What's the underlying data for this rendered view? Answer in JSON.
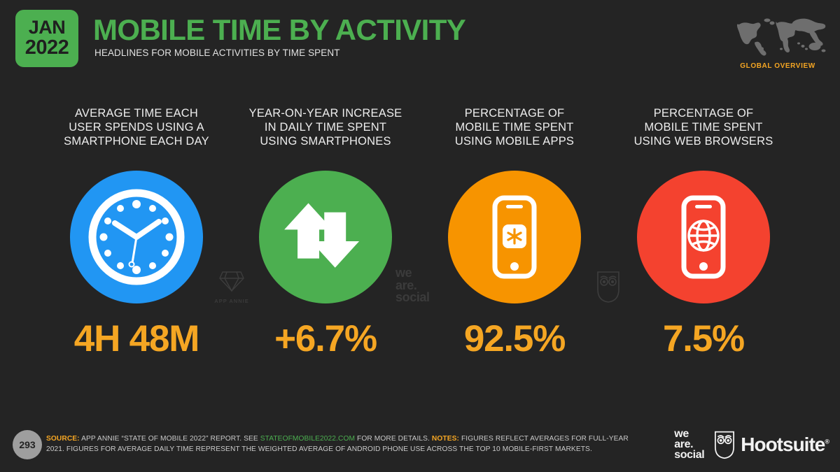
{
  "header": {
    "date_month": "JAN",
    "date_year": "2022",
    "title": "MOBILE TIME BY ACTIVITY",
    "subtitle": "HEADLINES FOR MOBILE ACTIVITIES BY TIME SPENT",
    "global_overview_label": "GLOBAL OVERVIEW"
  },
  "colors": {
    "background": "#242424",
    "brand_green": "#4caf50",
    "accent_orange": "#f5a623",
    "circle_blue": "#2196f3",
    "circle_green": "#4caf50",
    "circle_orange": "#f79400",
    "circle_red": "#f4422f"
  },
  "columns": [
    {
      "heading": "AVERAGE TIME EACH\nUSER SPENDS USING A\nSMARTPHONE EACH DAY",
      "icon": "clock-icon",
      "circle_color": "#2196f3",
      "value": "4H 48M"
    },
    {
      "heading": "YEAR-ON-YEAR INCREASE\nIN DAILY TIME SPENT\nUSING SMARTPHONES",
      "icon": "up-down-arrows-icon",
      "circle_color": "#4caf50",
      "value": "+6.7%"
    },
    {
      "heading": "PERCENTAGE OF\nMOBILE TIME SPENT\nUSING MOBILE APPS",
      "icon": "smartphone-app-icon",
      "circle_color": "#f79400",
      "value": "92.5%"
    },
    {
      "heading": "PERCENTAGE OF\nMOBILE TIME SPENT\nUSING WEB BROWSERS",
      "icon": "smartphone-browser-icon",
      "circle_color": "#f4422f",
      "value": "7.5%"
    }
  ],
  "watermarks": {
    "app_annie": "APP ANNIE",
    "we_are_social_l1": "we",
    "we_are_social_l2": "are.",
    "we_are_social_l3": "social",
    "hootsuite_owl": "hootsuite-owl-icon"
  },
  "footer": {
    "page_number": "293",
    "source_label": "SOURCE:",
    "source_text_1": "APP ANNIE “STATE OF MOBILE 2022” REPORT. SEE",
    "source_link": "STATEOFMOBILE2022.COM",
    "source_text_2": "FOR MORE DETAILS.",
    "notes_label": "NOTES:",
    "notes_text": "FIGURES REFLECT AVERAGES FOR FULL-YEAR 2021. FIGURES FOR AVERAGE DAILY TIME REPRESENT THE WEIGHTED AVERAGE OF ANDROID PHONE USE ACROSS THE TOP 10 MOBILE-FIRST MARKETS.",
    "logo_was_l1": "we",
    "logo_was_l2": "are.",
    "logo_was_l3": "social",
    "logo_hootsuite": "Hootsuite",
    "logo_hootsuite_mark": "®"
  }
}
